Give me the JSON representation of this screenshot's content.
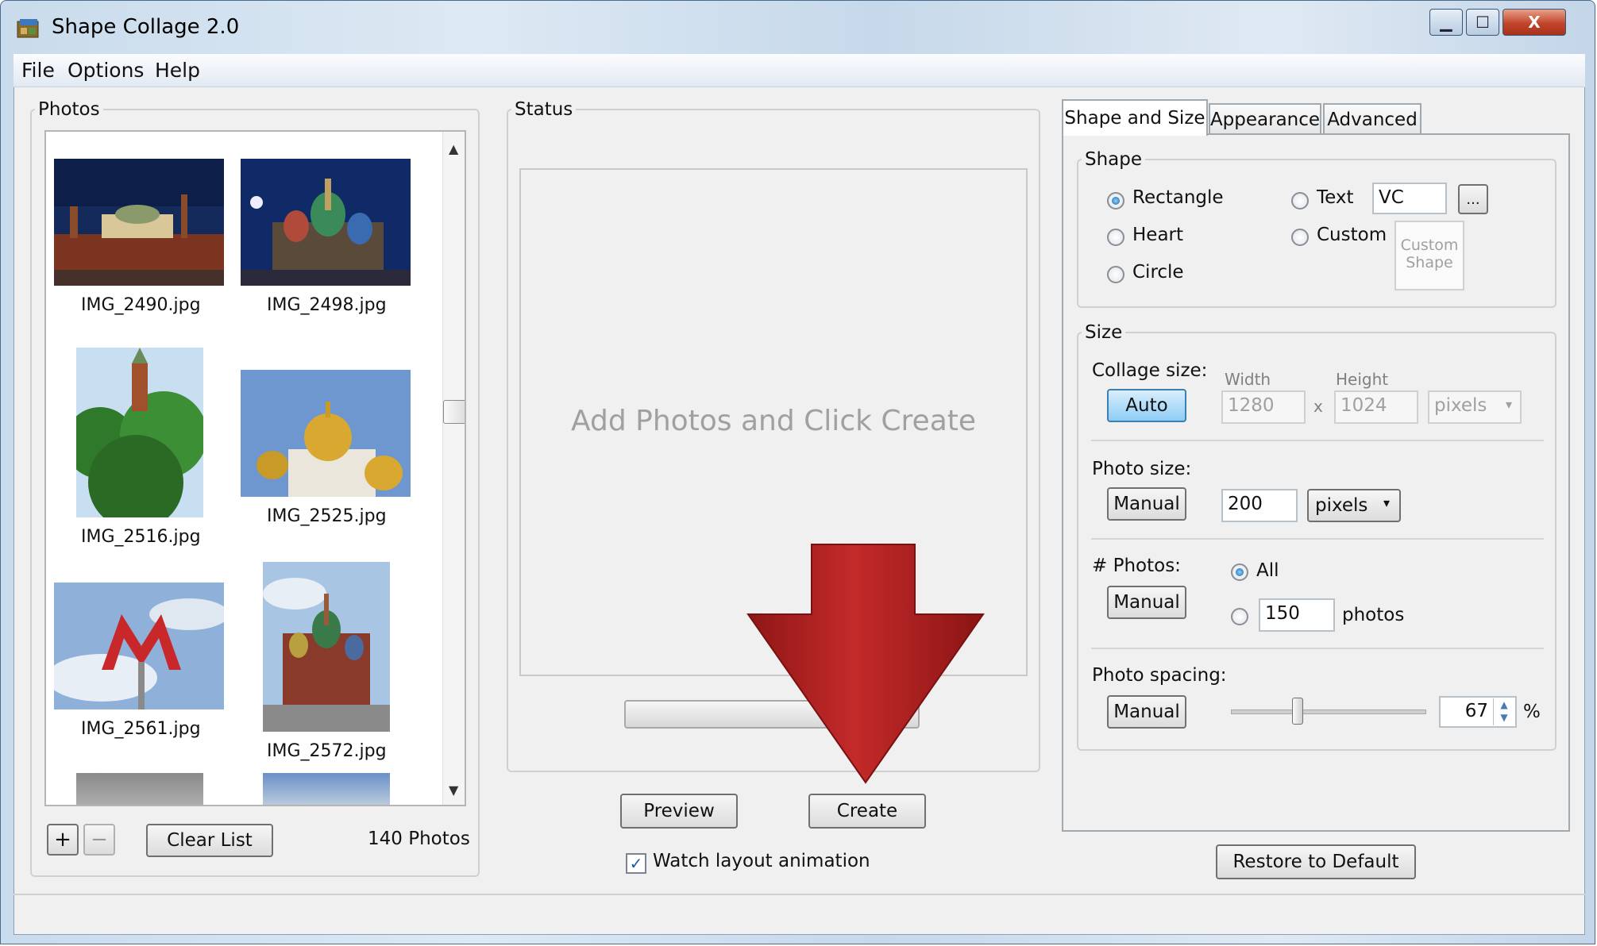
{
  "window": {
    "title": "Shape Collage 2.0",
    "minimize": "▁",
    "maximize": "☐",
    "close": "X"
  },
  "menu": [
    "File",
    "Options",
    "Help"
  ],
  "photos_panel": {
    "legend": "Photos",
    "items": [
      {
        "filename": "IMG_2490.jpg"
      },
      {
        "filename": "IMG_2498.jpg"
      },
      {
        "filename": "IMG_2516.jpg"
      },
      {
        "filename": "IMG_2525.jpg"
      },
      {
        "filename": "IMG_2561.jpg"
      },
      {
        "filename": "IMG_2572.jpg"
      }
    ],
    "add_label": "+",
    "remove_label": "−",
    "clear_label": "Clear List",
    "count_text": "140 Photos"
  },
  "status_panel": {
    "legend": "Status",
    "placeholder": "Add Photos and Click Create",
    "preview_label": "Preview",
    "create_label": "Create",
    "watch_label": "Watch layout animation",
    "watch_checked": true
  },
  "tabs": [
    "Shape and Size",
    "Appearance",
    "Advanced"
  ],
  "shape": {
    "legend": "Shape",
    "options": {
      "rectangle": "Rectangle",
      "heart": "Heart",
      "circle": "Circle",
      "text": "Text",
      "custom": "Custom"
    },
    "selected": "Rectangle",
    "text_value": "VC",
    "browse_label": "...",
    "custom_shape_line1": "Custom",
    "custom_shape_line2": "Shape"
  },
  "size": {
    "legend": "Size",
    "collage_label": "Collage size:",
    "auto_label": "Auto",
    "width_label": "Width",
    "height_label": "Height",
    "width_value": "1280",
    "height_value": "1024",
    "times": "x",
    "collage_unit": "pixels",
    "photo_size_label": "Photo size:",
    "photo_size_button": "Manual",
    "photo_size_value": "200",
    "photo_size_unit": "pixels",
    "photos_label": "# Photos:",
    "photos_button": "Manual",
    "photos_all_label": "All",
    "photos_count_value": "150",
    "photos_unit": "photos",
    "spacing_label": "Photo spacing:",
    "spacing_button": "Manual",
    "spacing_value": "67",
    "spacing_slider_fraction": 0.34,
    "spacing_unit": "%"
  },
  "restore_label": "Restore to Default",
  "colors": {
    "arrow": "#b22222",
    "auto_button": "#8ecdf5",
    "radio_selected": "#1462a8"
  }
}
